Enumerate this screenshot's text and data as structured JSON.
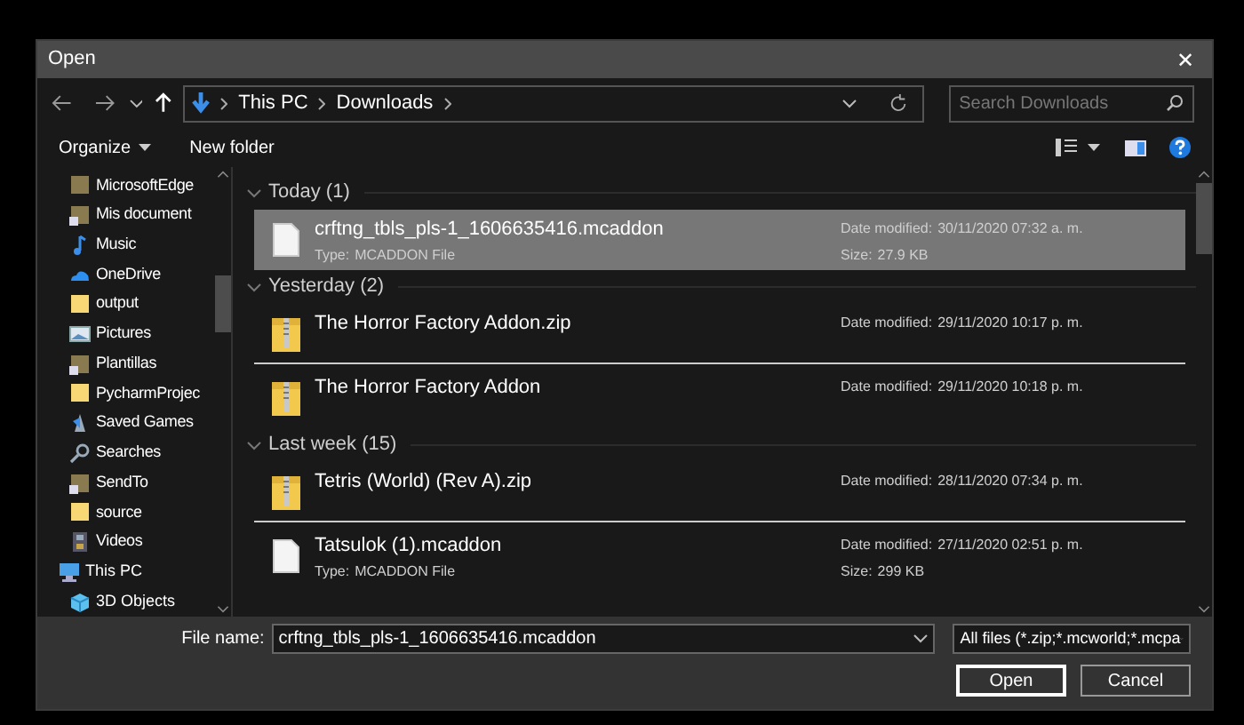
{
  "window": {
    "title": "Open",
    "close": "✕"
  },
  "address": {
    "crumbs": [
      "This PC",
      "Downloads"
    ],
    "search_placeholder": "Search Downloads"
  },
  "toolbar": {
    "organize": "Organize",
    "new_folder": "New folder"
  },
  "sidebar": {
    "nested_items": [
      {
        "label": "MicrosoftEdge",
        "kind": "folder-dark"
      },
      {
        "label": "Mis document",
        "kind": "shortcut"
      },
      {
        "label": "Music",
        "kind": "music"
      },
      {
        "label": "OneDrive",
        "kind": "cloud"
      },
      {
        "label": "output",
        "kind": "folder"
      },
      {
        "label": "Pictures",
        "kind": "pictures"
      },
      {
        "label": "Plantillas",
        "kind": "shortcut"
      },
      {
        "label": "PycharmProjec",
        "kind": "folder"
      },
      {
        "label": "Saved Games",
        "kind": "games"
      },
      {
        "label": "Searches",
        "kind": "search"
      },
      {
        "label": "SendTo",
        "kind": "shortcut"
      },
      {
        "label": "source",
        "kind": "folder"
      },
      {
        "label": "Videos",
        "kind": "videos"
      }
    ],
    "items": [
      {
        "label": "This PC",
        "kind": "pc",
        "children": [
          {
            "label": "3D Objects",
            "kind": "objects"
          }
        ]
      }
    ]
  },
  "groups": [
    {
      "header": "Today (1)",
      "expanded": true,
      "files": [
        {
          "name": "crftng_tbls_pls-1_1606635416.mcaddon",
          "kind": "file",
          "selected": true,
          "type_label": "Type:",
          "type": "MCADDON File",
          "date_label": "Date modified:",
          "date": "30/11/2020 07:32 a. m.",
          "size_label": "Size:",
          "size": "27.9 KB"
        }
      ]
    },
    {
      "header": "Yesterday (2)",
      "expanded": true,
      "files": [
        {
          "name": "The Horror Factory Addon.zip",
          "kind": "zip",
          "selected": false,
          "date_label": "Date modified:",
          "date": "29/11/2020 10:17 p. m."
        },
        {
          "name": "The Horror Factory Addon",
          "kind": "zip",
          "selected": false,
          "date_label": "Date modified:",
          "date": "29/11/2020 10:18 p. m."
        }
      ]
    },
    {
      "header": "Last week (15)",
      "expanded": true,
      "files": [
        {
          "name": "Tetris (World) (Rev A).zip",
          "kind": "zip",
          "selected": false,
          "date_label": "Date modified:",
          "date": "28/11/2020 07:34 p. m."
        },
        {
          "name": "Tatsulok (1).mcaddon",
          "kind": "file",
          "selected": false,
          "type_label": "Type:",
          "type": "MCADDON File",
          "date_label": "Date modified:",
          "date": "27/11/2020 02:51 p. m.",
          "size_label": "Size:",
          "size": "299 KB"
        }
      ]
    }
  ],
  "footer": {
    "file_name_label": "File name:",
    "file_name": "crftng_tbls_pls-1_1606635416.mcaddon",
    "filter": "All files (*.zip;*.mcworld;*.mcpa",
    "open": "Open",
    "cancel": "Cancel"
  }
}
